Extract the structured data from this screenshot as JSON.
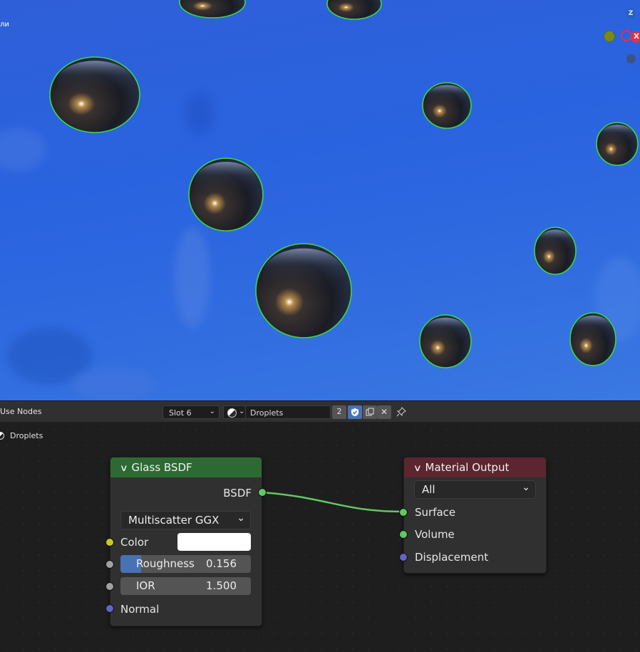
{
  "viewport": {
    "corner_label": "ли",
    "gizmo": {
      "z_label": "Z",
      "x_label": "X"
    }
  },
  "header": {
    "use_nodes_label": "Use Nodes",
    "slot_value": "Slot 6",
    "material_name": "Droplets",
    "user_count": "2"
  },
  "editor": {
    "breadcrumb": "Droplets",
    "glass_node": {
      "title": "Glass BSDF",
      "output_socket": "BSDF",
      "distribution": "Multiscatter GGX",
      "color_label": "Color",
      "color_value": "#ffffff",
      "roughness_label": "Roughness",
      "roughness_value": "0.156",
      "roughness_fraction": 0.156,
      "ior_label": "IOR",
      "ior_value": "1.500",
      "normal_label": "Normal"
    },
    "output_node": {
      "title": "Material Output",
      "target": "All",
      "surface_label": "Surface",
      "volume_label": "Volume",
      "displacement_label": "Displacement"
    }
  },
  "colors": {
    "glass_header": "#2d6a33",
    "output_header": "#5c2530",
    "shader_socket": "#63c763",
    "color_socket": "#c7c729",
    "float_socket": "#a1a1a1",
    "vector_socket": "#6363c7",
    "selection_outline": "#3ad64e",
    "link": "#63c763"
  }
}
